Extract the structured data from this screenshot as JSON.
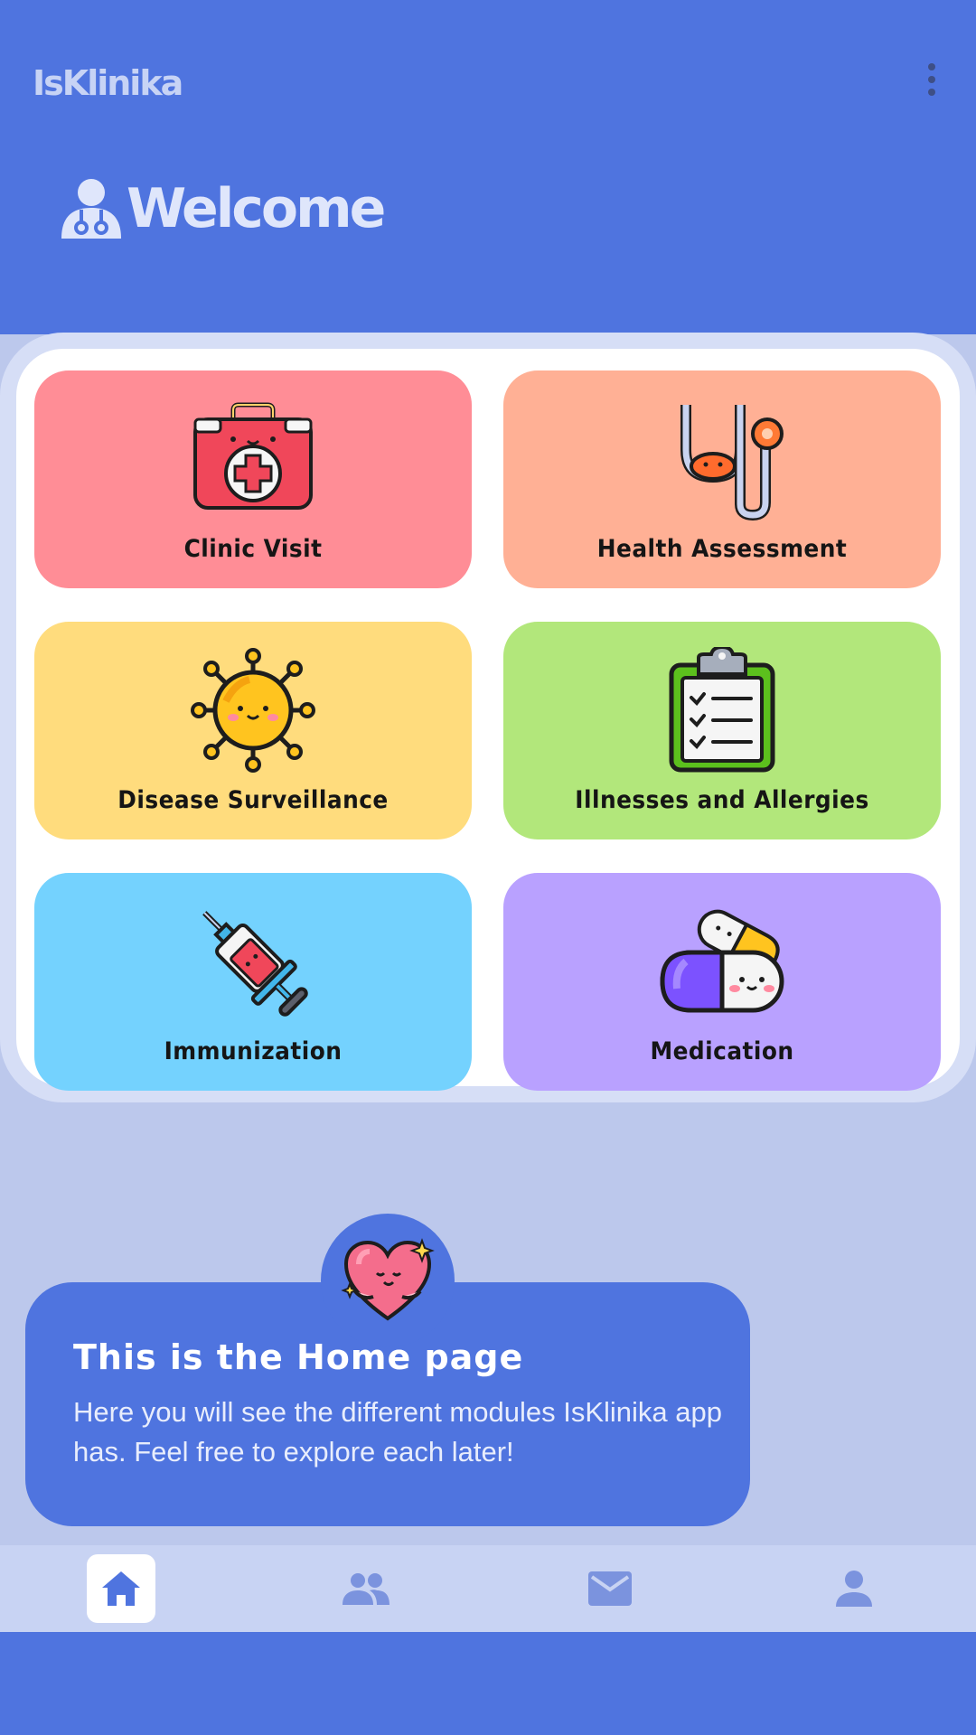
{
  "app": {
    "title": "IsKlinika"
  },
  "header": {
    "welcome": "Welcome",
    "menu_icon": "more-vert-icon",
    "welcome_icon": "doctor-icon"
  },
  "modules": [
    {
      "label": "Clinic Visit",
      "icon": "first-aid-kit-icon",
      "color": "#ff8d96"
    },
    {
      "label": "Health Assessment",
      "icon": "stethoscope-icon",
      "color": "#ffb095"
    },
    {
      "label": "Disease Surveillance",
      "icon": "virus-icon",
      "color": "#ffdc7d"
    },
    {
      "label": "Illnesses and Allergies",
      "icon": "clipboard-icon",
      "color": "#b2e77b"
    },
    {
      "label": "Immunization",
      "icon": "syringe-icon",
      "color": "#74d2fe"
    },
    {
      "label": "Medication",
      "icon": "pills-icon",
      "color": "#b9a1ff"
    }
  ],
  "tip": {
    "title": "This is the Home page",
    "body": "Here you will see the different modules IsKlinika app has. Feel free to explore each later!",
    "icon": "heart-icon"
  },
  "nav": [
    {
      "name": "home",
      "icon": "home-icon",
      "active": true
    },
    {
      "name": "people",
      "icon": "people-icon",
      "active": false
    },
    {
      "name": "messages",
      "icon": "mail-icon",
      "active": false
    },
    {
      "name": "profile",
      "icon": "person-icon",
      "active": false
    }
  ],
  "colors": {
    "primary": "#4f74df",
    "background": "#bcc8ec",
    "nav_bg": "#c8d3f3",
    "nav_icon": "#7b93de"
  }
}
